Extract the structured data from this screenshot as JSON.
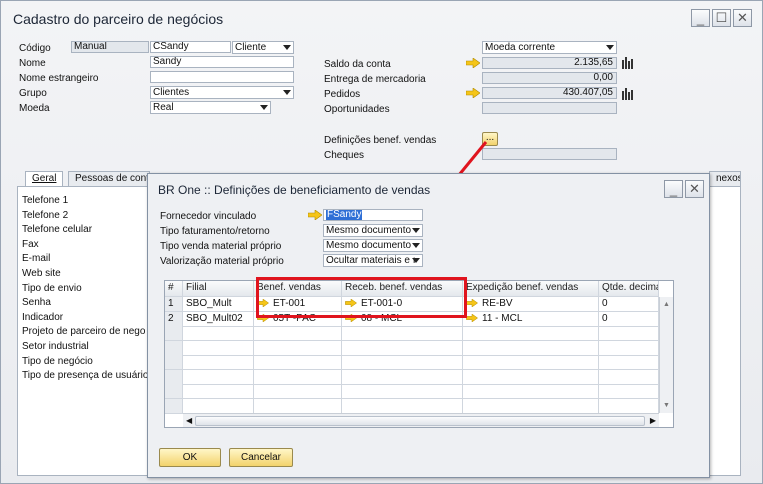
{
  "window": {
    "title": "Cadastro do parceiro de negócios",
    "min": "_",
    "max": "☐",
    "close": "✕"
  },
  "form": {
    "codigo_label": "Código",
    "codigo_type": "Manual",
    "codigo_value": "CSandy",
    "codigo_kind": "Cliente",
    "nome_label": "Nome",
    "nome_value": "Sandy",
    "nome_estr_label": "Nome estrangeiro",
    "nome_estr_value": "",
    "grupo_label": "Grupo",
    "grupo_value": "Clientes",
    "moeda_label": "Moeda",
    "moeda_value": "Real",
    "moeda_corrente": "Moeda corrente",
    "saldo_label": "Saldo da conta",
    "saldo_value": "2.135,65",
    "entrega_label": "Entrega de mercadoria",
    "entrega_value": "0,00",
    "pedidos_label": "Pedidos",
    "pedidos_value": "430.407,05",
    "oportunidades_label": "Oportunidades",
    "oportunidades_value": "",
    "def_benef_label": "Definições benef. vendas",
    "def_benef_btn": "...",
    "cheques_label": "Cheques",
    "cheques_value": ""
  },
  "tabs": {
    "geral": "Geral",
    "pessoas": "Pessoas de conta",
    "anexos": "nexos"
  },
  "geral_fields": [
    "Telefone 1",
    "Telefone 2",
    "Telefone celular",
    "Fax",
    "E-mail",
    "Web site",
    "Tipo de envio",
    "Senha",
    "Indicador",
    "Projeto de parceiro de nego",
    "Setor industrial",
    "Tipo de negócio",
    "Tipo de presença de usuário"
  ],
  "dialog": {
    "title": "BR One :: Definições de beneficiamento de vendas",
    "fornecedor_label": "Fornecedor vinculado",
    "fornecedor_value": "FSandy",
    "tipo_fat_label": "Tipo faturamento/retorno",
    "tipo_fat_value": "Mesmo documento",
    "tipo_venda_label": "Tipo venda material próprio",
    "tipo_venda_value": "Mesmo documento",
    "valorizacao_label": "Valorização material próprio",
    "valorizacao_value": "Ocultar materiais e ı",
    "ok": "OK",
    "cancel": "Cancelar",
    "columns": [
      "#",
      "Filial",
      "Benef. vendas",
      "Receb. benef. vendas",
      "Expedição benef. vendas",
      "Qtde. decimais"
    ],
    "rows": [
      {
        "n": "1",
        "filial": "SBO_Mult",
        "benef": "ET-001",
        "receb": "ET-001-0",
        "exped": "RE-BV",
        "qtde": "0"
      },
      {
        "n": "2",
        "filial": "SBO_Mult02",
        "benef": "05T -PAC",
        "receb": "08 - MCL",
        "exped": "11 - MCL",
        "qtde": "0"
      }
    ]
  },
  "colors": {
    "highlight": "#e0141e",
    "arrow_yellow": "#f5c518",
    "selection": "#2f6fd6"
  }
}
